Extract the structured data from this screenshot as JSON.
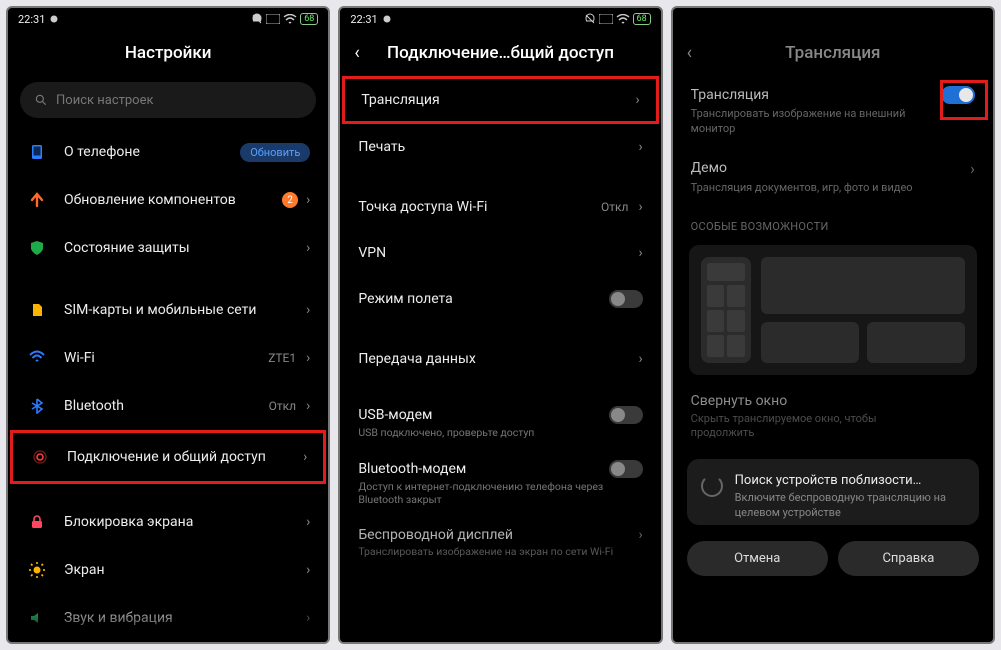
{
  "status": {
    "time": "22:31",
    "battery": "68"
  },
  "screen1": {
    "title": "Настройки",
    "search_placeholder": "Поиск настроек",
    "about": "О телефоне",
    "update_pill": "Обновить",
    "components": "Обновление компонентов",
    "components_badge": "2",
    "security": "Состояние защиты",
    "sim": "SIM-карты и мобильные сети",
    "wifi": "Wi-Fi",
    "wifi_value": "ZTE1",
    "bt": "Bluetooth",
    "bt_value": "Откл",
    "connection": "Подключение и общий доступ",
    "lock": "Блокировка экрана",
    "screen": "Экран",
    "sound": "Звук и вибрация"
  },
  "screen2": {
    "title": "Подключение…бщий доступ",
    "cast": "Трансляция",
    "print": "Печать",
    "hotspot": "Точка доступа Wi-Fi",
    "hotspot_value": "Откл",
    "vpn": "VPN",
    "airplane": "Режим полета",
    "data": "Передача данных",
    "usb": "USB-модем",
    "usb_sub": "USB подключено, проверьте доступ",
    "btmodem": "Bluetooth-модем",
    "btmodem_sub": "Доступ к интернет-подключению телефона через Bluetooth закрыт",
    "wireless": "Беспроводной дисплей",
    "wireless_sub": "Транслировать изображение на экран по сети Wi-Fi"
  },
  "screen3": {
    "title": "Трансляция",
    "cast": "Трансляция",
    "cast_sub": "Транслировать изображение на внешний монитор",
    "demo": "Демо",
    "demo_sub": "Трансляция документов, игр, фото и видео",
    "special": "ОСОБЫЕ ВОЗМОЖНОСТИ",
    "minimize": "Свернуть окно",
    "minimize_sub": "Скрыть транслируемое окно, чтобы продолжить",
    "searching": "Поиск устройств поблизости…",
    "searching_sub": "Включите беспроводную трансляцию на целевом устройстве",
    "cancel": "Отмена",
    "help": "Справка"
  }
}
